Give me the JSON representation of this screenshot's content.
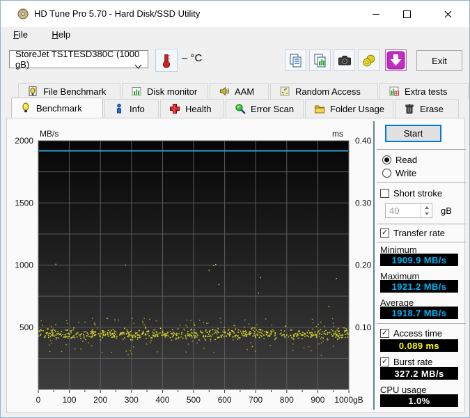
{
  "window": {
    "title": "HD Tune Pro 5.70 - Hard Disk/SSD Utility"
  },
  "menu": {
    "items": [
      {
        "label": "File"
      },
      {
        "label": "Help"
      }
    ]
  },
  "toolbar": {
    "drive_select": "StoreJet TS1TESD380C (1000 gB)",
    "temperature_display": "– °C",
    "exit_label": "Exit"
  },
  "tabs_back": [
    {
      "label": "File Benchmark"
    },
    {
      "label": "Disk monitor"
    },
    {
      "label": "AAM"
    },
    {
      "label": "Random Access"
    },
    {
      "label": "Extra tests"
    }
  ],
  "tabs_front": [
    {
      "label": "Benchmark",
      "selected": true
    },
    {
      "label": "Info"
    },
    {
      "label": "Health"
    },
    {
      "label": "Error Scan"
    },
    {
      "label": "Folder Usage"
    },
    {
      "label": "Erase"
    }
  ],
  "panel": {
    "start_label": "Start",
    "read_label": "Read",
    "write_label": "Write",
    "read_selected": true,
    "short_stroke_label": "Short stroke",
    "short_stroke_checked": false,
    "capacity_value": "40",
    "capacity_unit": "gB",
    "transfer_rate_label": "Transfer rate",
    "transfer_rate_checked": true,
    "minimum_label": "Minimum",
    "minimum_value": "1909.9 MB/s",
    "maximum_label": "Maximum",
    "maximum_value": "1921.2 MB/s",
    "average_label": "Average",
    "average_value": "1918.7 MB/s",
    "access_time_label": "Access time",
    "access_time_checked": true,
    "access_time_value": "0.089 ms",
    "burst_rate_label": "Burst rate",
    "burst_rate_checked": true,
    "burst_rate_value": "327.2 MB/s",
    "cpu_usage_label": "CPU usage",
    "cpu_usage_value": "1.0%"
  },
  "chart_data": {
    "type": "scatter",
    "title": "",
    "x_axis": {
      "unit": "gB",
      "min": 0,
      "max": 1000,
      "gridline_step": 100,
      "minor_tick_step": 50,
      "tick_labels": [
        "0",
        "100",
        "200",
        "300",
        "400",
        "500",
        "600",
        "700",
        "800",
        "900",
        "1000gB"
      ]
    },
    "y_left_axis": {
      "label": "MB/s",
      "min": 0,
      "max": 2000,
      "gridline_step": 250,
      "tick_labels": [
        "2000",
        "1500",
        "1000",
        "500"
      ]
    },
    "y_right_axis": {
      "label": "ms",
      "min": 0,
      "max": 0.4,
      "tick_labels": [
        "0.40",
        "0.30",
        "0.20",
        "0.10"
      ]
    },
    "transfer_rate_line": {
      "name": "Transfer rate",
      "value_mb_s": 1919.0,
      "min_mb_s": 1909.9,
      "max_mb_s": 1921.2,
      "avg_mb_s": 1918.7,
      "color": "#2f9fd0"
    },
    "access_time_scatter": {
      "name": "Access time",
      "avg_ms": 0.089,
      "color": "#d9d92a",
      "band_center_ms": 0.089,
      "band_spread_ms": 0.004,
      "upper_range_ms": [
        0.095,
        0.115
      ],
      "lower_range_ms": [
        0.055,
        0.085
      ],
      "outlier_range_ms": [
        0.13,
        0.21
      ],
      "counts": {
        "band": 620,
        "upper": 70,
        "lower": 55,
        "outliers": 10
      },
      "seed": 42
    },
    "plot_bg_gradient": [
      "#060606",
      "#3d3d3d"
    ],
    "grid_color": "#5c5c5c",
    "grid_on": true
  }
}
